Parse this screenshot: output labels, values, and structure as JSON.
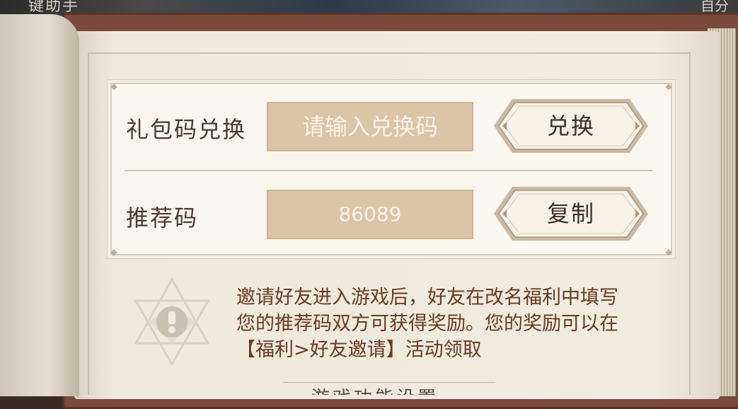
{
  "background": {
    "top_left_text": "键助手",
    "top_right_text": "自分"
  },
  "gift_code": {
    "label": "礼包码兑换",
    "input_placeholder": "请输入兑换码",
    "input_value": "",
    "button_label": "兑换"
  },
  "referral": {
    "label": "推荐码",
    "code": "86089",
    "button_label": "复制"
  },
  "notice": {
    "lines": [
      "邀请好友进入游戏后，好友在改名福利中填写",
      "您的推荐码双方可获得奖励。您的奖励可以在",
      "【福利>好友邀请】活动领取"
    ]
  },
  "footer": {
    "section_title": "游戏功能设置"
  },
  "colors": {
    "label_text": "#4a3a33",
    "notice_text": "#6b3a22",
    "input_bg": "#dcc4a6",
    "panel_bg": "#faf7f0",
    "book_frame": "#7a4a3a"
  },
  "icons": {
    "notice": "warning-icon"
  }
}
